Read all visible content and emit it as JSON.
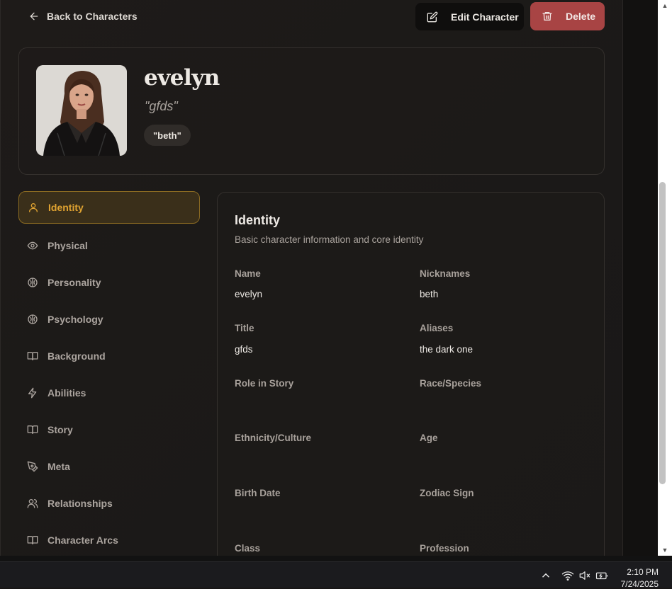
{
  "header": {
    "back_label": "Back to Characters",
    "edit_label": "Edit Character",
    "delete_label": "Delete"
  },
  "profile": {
    "name": "evelyn",
    "title": "\"gfds\"",
    "nickname_badge": "\"beth\""
  },
  "nav": {
    "items": [
      {
        "label": "Identity",
        "icon": "user-icon",
        "active": true
      },
      {
        "label": "Physical",
        "icon": "eye-icon"
      },
      {
        "label": "Personality",
        "icon": "brain-icon"
      },
      {
        "label": "Psychology",
        "icon": "brain-icon"
      },
      {
        "label": "Background",
        "icon": "book-open-icon"
      },
      {
        "label": "Abilities",
        "icon": "lightning-icon"
      },
      {
        "label": "Story",
        "icon": "book-open-icon"
      },
      {
        "label": "Meta",
        "icon": "pen-tool-icon"
      },
      {
        "label": "Relationships",
        "icon": "users-icon"
      },
      {
        "label": "Character Arcs",
        "icon": "book-open-icon"
      }
    ]
  },
  "section": {
    "title": "Identity",
    "description": "Basic character information and core identity",
    "fields": [
      {
        "label": "Name",
        "value": "evelyn"
      },
      {
        "label": "Nicknames",
        "value": "beth"
      },
      {
        "label": "Title",
        "value": "gfds"
      },
      {
        "label": "Aliases",
        "value": "the dark one"
      },
      {
        "label": "Role in Story",
        "value": ""
      },
      {
        "label": "Race/Species",
        "value": ""
      },
      {
        "label": "Ethnicity/Culture",
        "value": ""
      },
      {
        "label": "Age",
        "value": ""
      },
      {
        "label": "Birth Date",
        "value": ""
      },
      {
        "label": "Zodiac Sign",
        "value": ""
      },
      {
        "label": "Class",
        "value": ""
      },
      {
        "label": "Profession",
        "value": ""
      }
    ]
  },
  "taskbar": {
    "time": "2:10 PM",
    "date": "7/24/2025",
    "tray_icons": [
      "chevron-up-icon",
      "wifi-icon",
      "speaker-muted-icon",
      "battery-charging-icon"
    ]
  },
  "colors": {
    "accent": "#e0a331",
    "danger": "#a84444",
    "background": "#1c1a18"
  }
}
